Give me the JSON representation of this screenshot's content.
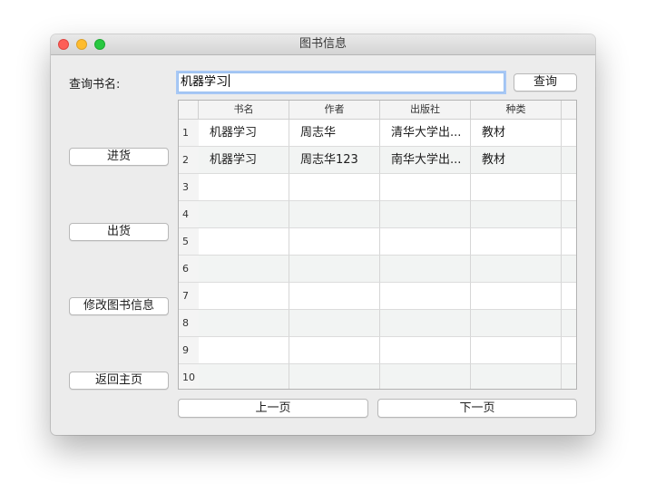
{
  "window": {
    "title": "图书信息"
  },
  "query": {
    "label": "查询书名:",
    "value": "机器学习",
    "button": "查询"
  },
  "side_buttons": {
    "stock_in": "进货",
    "stock_out": "出货",
    "edit": "修改图书信息",
    "home": "返回主页"
  },
  "table": {
    "headers": [
      "书名",
      "作者",
      "出版社",
      "种类"
    ],
    "row_numbers": [
      "1",
      "2",
      "3",
      "4",
      "5",
      "6",
      "7",
      "8",
      "9",
      "10"
    ],
    "rows": [
      [
        "机器学习",
        "周志华",
        "清华大学出...",
        "教材"
      ],
      [
        "机器学习",
        "周志华123",
        "南华大学出...",
        "教材"
      ],
      [
        "",
        "",
        "",
        ""
      ],
      [
        "",
        "",
        "",
        ""
      ],
      [
        "",
        "",
        "",
        ""
      ],
      [
        "",
        "",
        "",
        ""
      ],
      [
        "",
        "",
        "",
        ""
      ],
      [
        "",
        "",
        "",
        ""
      ],
      [
        "",
        "",
        "",
        ""
      ],
      [
        "",
        "",
        "",
        ""
      ]
    ]
  },
  "pager": {
    "prev": "上一页",
    "next": "下一页"
  }
}
